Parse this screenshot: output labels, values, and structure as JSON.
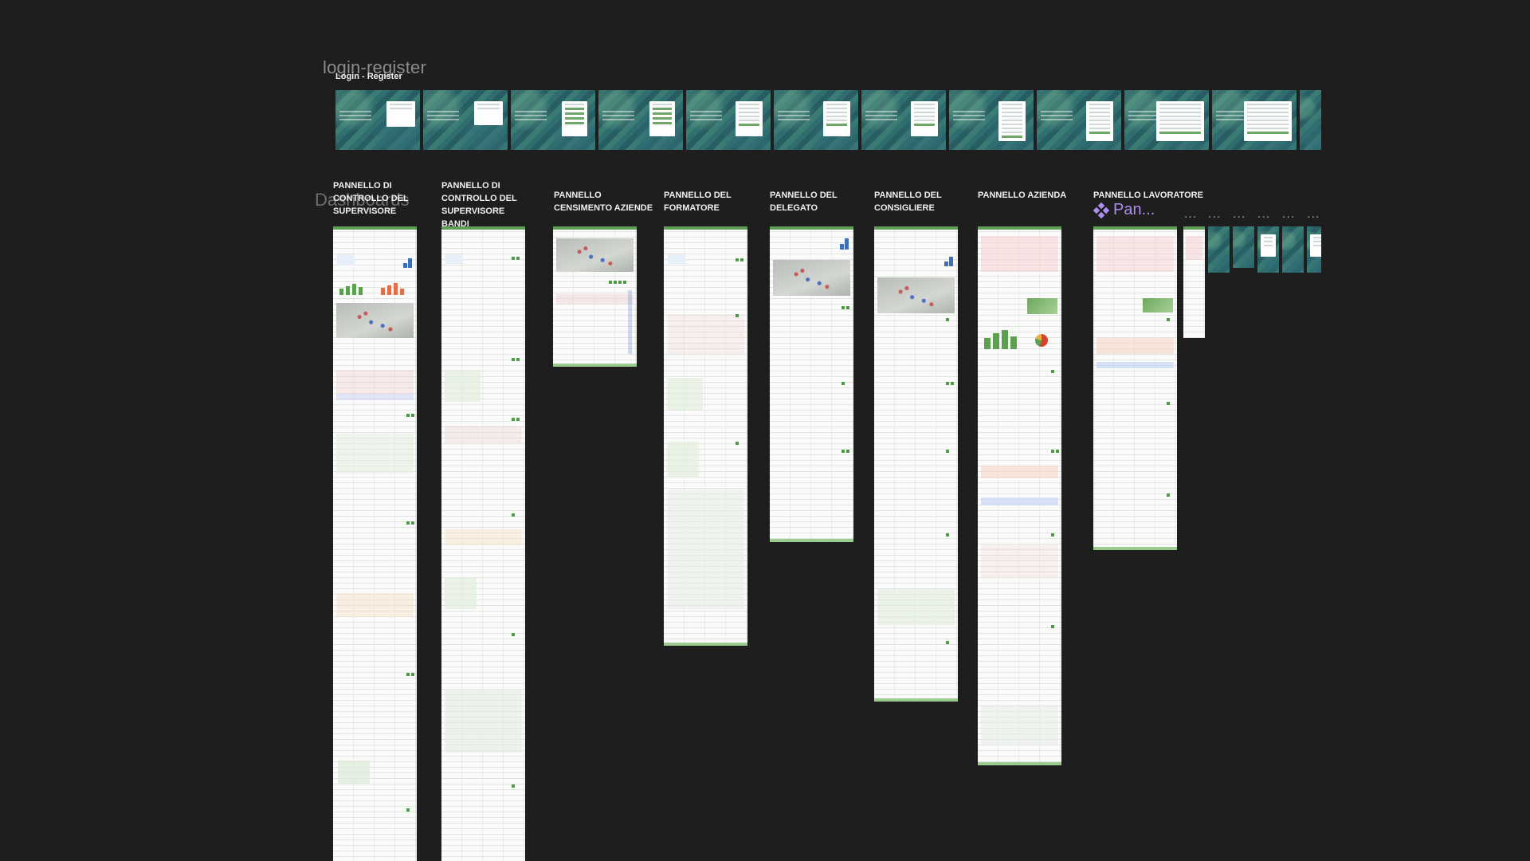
{
  "canvas": {
    "section_title": "login-register",
    "login_frame_label": "Login - Register",
    "ghost_label": "Dashboards",
    "component_label": "Pan...",
    "component_icon": "component-diamond-icon",
    "ellipsis": "..."
  },
  "panels": [
    {
      "label": "PANNELLO DI CONTROLLO DEL SUPERVISORE"
    },
    {
      "label": "PANNELLO DI CONTROLLO DEL SUPERVISORE BANDI"
    },
    {
      "label": "PANNELLO CENSIMENTO AZIENDE"
    },
    {
      "label": "PANNELLO DEL FORMATORE"
    },
    {
      "label": "PANNELLO DEL DELEGATO"
    },
    {
      "label": "PANNELLO DEL CONSIGLIERE"
    },
    {
      "label": "PANNELLO AZIENDA"
    },
    {
      "label": "PANNELLO LAVORATORE"
    }
  ],
  "colors": {
    "canvas_bg": "#1e1e1e",
    "accent_green": "#5e9e55",
    "component_purple": "#b18cf0",
    "login_teal": "#2f6d6e"
  }
}
